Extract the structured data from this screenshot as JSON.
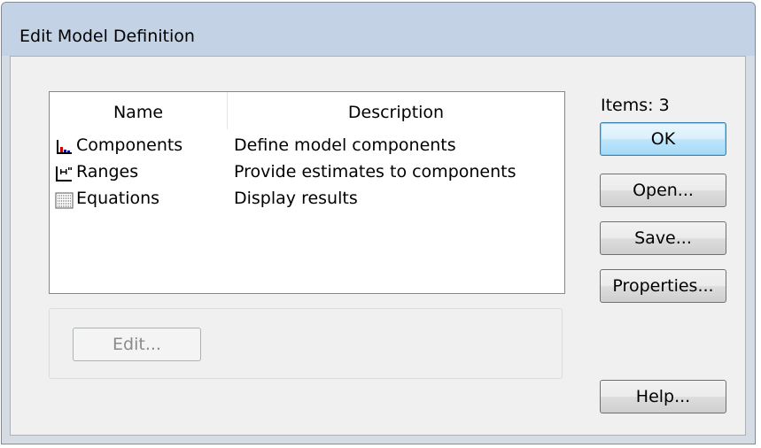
{
  "window": {
    "title": "Edit Model Definition"
  },
  "list": {
    "columns": [
      "Name",
      "Description"
    ],
    "rows": [
      {
        "icon": "chart-icon",
        "name": "Components",
        "description": "Define model components"
      },
      {
        "icon": "range-icon",
        "name": "Ranges",
        "description": "Provide estimates to components"
      },
      {
        "icon": "equations-icon",
        "name": "Equations",
        "description": "Display results"
      }
    ]
  },
  "panel": {
    "edit_label": "Edit..."
  },
  "side": {
    "items_label": "Items: 3",
    "ok_label": "OK",
    "open_label": "Open...",
    "save_label": "Save...",
    "properties_label": "Properties...",
    "help_label": "Help..."
  },
  "colors": {
    "titlebar": "#c3d2e4",
    "client": "#f0f0f0",
    "default_button_border": "#3c7fb1"
  }
}
